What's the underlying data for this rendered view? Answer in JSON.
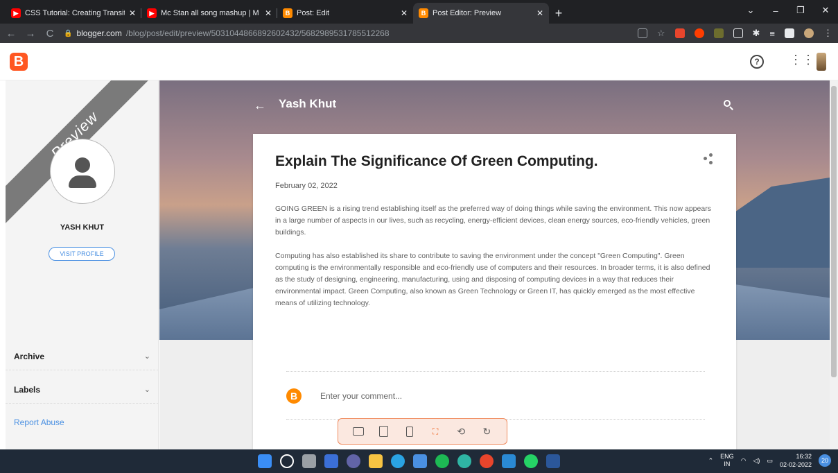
{
  "browser": {
    "tabs": [
      {
        "title": "CSS Tutorial: Creating Transitions",
        "favicon": "youtube-icon",
        "active": false
      },
      {
        "title": "Mc Stan all song mashup | M",
        "favicon": "youtube-icon",
        "active": false
      },
      {
        "title": "Post: Edit",
        "favicon": "blogger-icon",
        "active": false
      },
      {
        "title": "Post Editor: Preview",
        "favicon": "blogger-icon",
        "active": true
      }
    ],
    "url_host": "blogger.com",
    "url_path": "/blog/post/edit/preview/5031044866892602432/5682989531785512268"
  },
  "sidebar": {
    "ribbon": "Preview",
    "profile_name": "YASH KHUT",
    "visit_profile": "VISIT PROFILE",
    "sections": [
      {
        "label": "Archive"
      },
      {
        "label": "Labels"
      }
    ],
    "report_abuse": "Report Abuse"
  },
  "blog": {
    "title": "Yash Khut"
  },
  "post": {
    "title": "Explain The Significance Of Green Computing.",
    "date": "February 02, 2022",
    "paragraphs": [
      " GOING GREEN is a rising trend establishing itself as the preferred way of doing things while saving the environment. This now appears in a large number of aspects in our lives, such as recycling, energy-efficient devices, clean energy sources, eco-friendly vehicles, green buildings.",
      "Computing has also established its share to contribute to saving the environment under the concept \"Green Computing\". Green computing is the environmentally responsible and eco-friendly use of computers and their resources. In broader terms, it is also defined as the study of designing, engineering, manufacturing, using and disposing of computing devices in a way that reduces their environmental impact. Green Computing, also known as Green Technology or Green IT, has quickly emerged as the most effective means of utilizing technology."
    ],
    "comment_placeholder": "Enter your comment..."
  },
  "taskbar": {
    "lang_top": "ENG",
    "lang_bottom": "IN",
    "time": "16:32",
    "date": "02-02-2022",
    "notifications": "20"
  },
  "colors": {
    "blogger_orange": "#ff5722",
    "link_blue": "#4a90e2"
  }
}
